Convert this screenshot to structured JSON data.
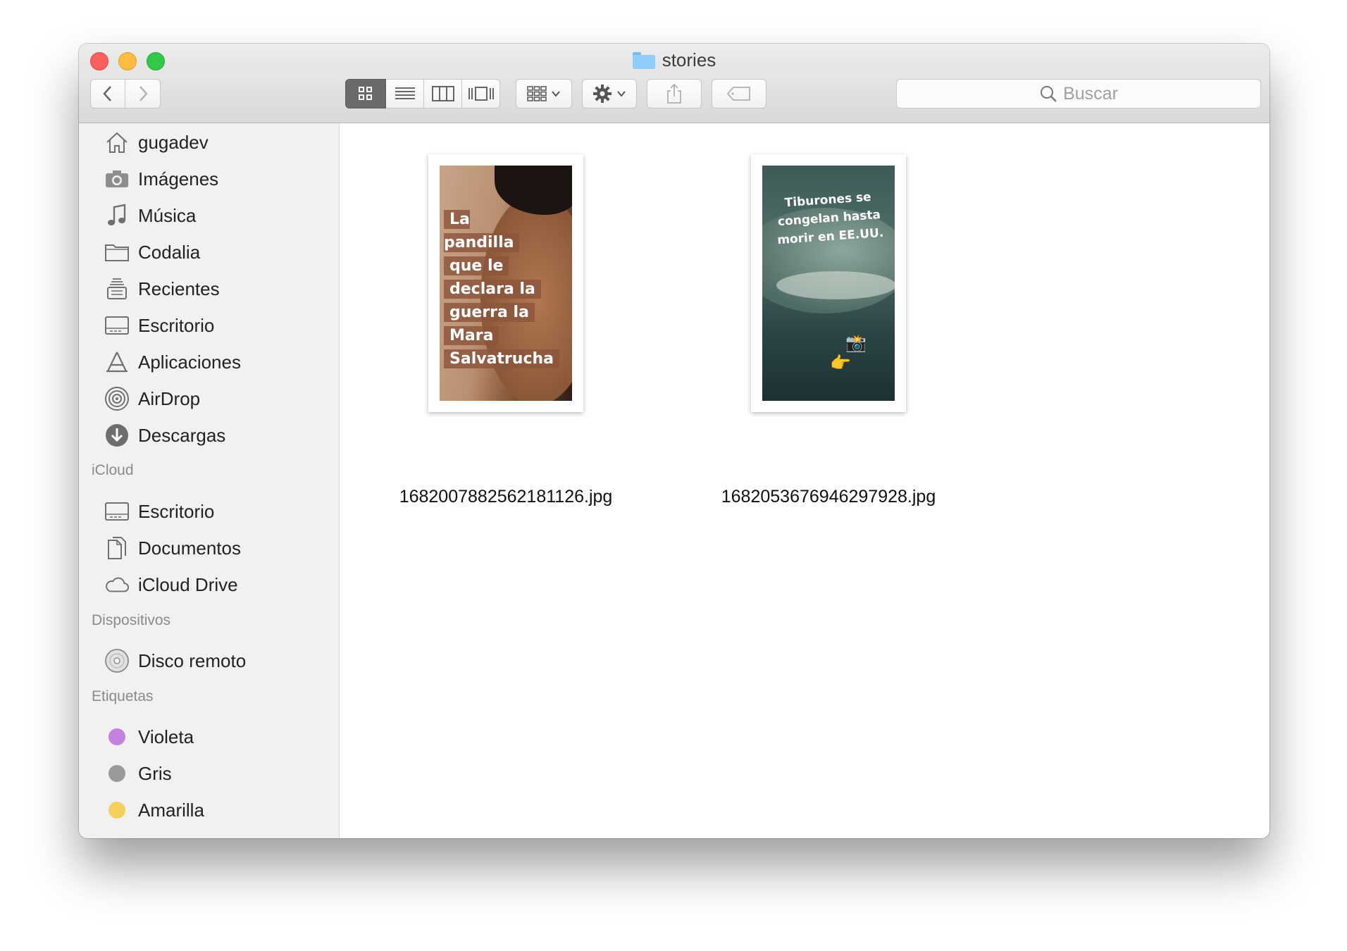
{
  "window": {
    "title": "stories"
  },
  "toolbar": {
    "back_icon": "chevron-left-icon",
    "forward_icon": "chevron-right-icon",
    "views": [
      "icon-view",
      "list-view",
      "column-view",
      "cover-flow-view"
    ],
    "active_view": "icon-view",
    "arrange_icon": "arrange-grid-icon",
    "action_icon": "gear-icon",
    "share_icon": "share-icon",
    "tags_icon": "tag-icon"
  },
  "search": {
    "placeholder": "Buscar"
  },
  "sidebar": {
    "favorites": [
      {
        "label": "gugadev",
        "icon": "home-icon"
      },
      {
        "label": "Imágenes",
        "icon": "camera-icon"
      },
      {
        "label": "Música",
        "icon": "music-note-icon"
      },
      {
        "label": "Codalia",
        "icon": "folder-icon"
      },
      {
        "label": "Recientes",
        "icon": "recents-icon"
      },
      {
        "label": "Escritorio",
        "icon": "desktop-icon"
      },
      {
        "label": "Aplicaciones",
        "icon": "applications-icon"
      },
      {
        "label": "AirDrop",
        "icon": "airdrop-icon"
      },
      {
        "label": "Descargas",
        "icon": "download-icon"
      }
    ],
    "icloud_header": "iCloud",
    "icloud": [
      {
        "label": "Escritorio",
        "icon": "desktop-icon"
      },
      {
        "label": "Documentos",
        "icon": "documents-icon"
      },
      {
        "label": "iCloud Drive",
        "icon": "cloud-icon"
      }
    ],
    "devices_header": "Dispositivos",
    "devices": [
      {
        "label": "Disco remoto",
        "icon": "disc-icon"
      }
    ],
    "tags_header": "Etiquetas",
    "tags": [
      {
        "label": "Violeta",
        "color": "#c581e0"
      },
      {
        "label": "Gris",
        "color": "#9a9a9a"
      },
      {
        "label": "Amarilla",
        "color": "#f5d05e"
      }
    ]
  },
  "files": [
    {
      "name": "1682007882562181126.jpg",
      "thumbnail_text": [
        "La pandilla",
        "que le",
        "declara la",
        "guerra la",
        "Mara",
        "Salvatrucha"
      ]
    },
    {
      "name": "1682053676946297928.jpg",
      "thumbnail_text": [
        "Tiburones se",
        "congelan hasta",
        "morir en EE.UU."
      ],
      "thumbnail_emoji": [
        "📸",
        "👉"
      ]
    }
  ]
}
